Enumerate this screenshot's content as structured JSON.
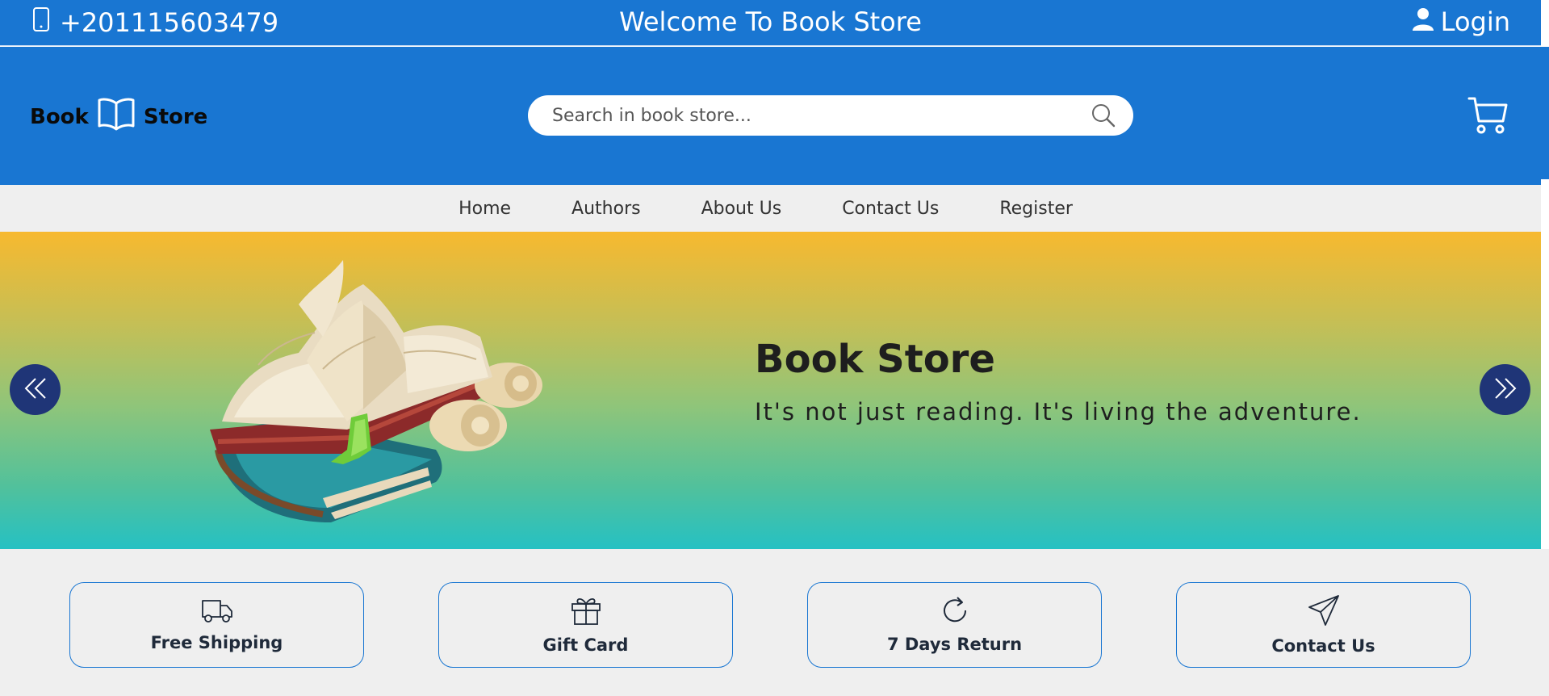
{
  "topbar": {
    "phone": "+201115603479",
    "welcome": "Welcome To Book Store",
    "login_label": "Login"
  },
  "header": {
    "logo_left": "Book",
    "logo_right": "Store",
    "search_placeholder": "Search in book store..."
  },
  "nav": {
    "items": [
      "Home",
      "Authors",
      "About Us",
      "Contact Us",
      "Register"
    ]
  },
  "hero": {
    "title": "Book Store",
    "subtitle": "It's not just reading. It's living the adventure."
  },
  "features": [
    {
      "label": "Free Shipping",
      "icon": "truck-icon"
    },
    {
      "label": "Gift Card",
      "icon": "gift-icon"
    },
    {
      "label": "7 Days Return",
      "icon": "refresh-icon"
    },
    {
      "label": "Contact Us",
      "icon": "send-icon"
    }
  ],
  "colors": {
    "primary": "#1976d2",
    "nav_bg": "#efefef",
    "arrow_bg": "#1f3577",
    "hero_top": "#f7b92f",
    "hero_bottom": "#25c1c3"
  }
}
